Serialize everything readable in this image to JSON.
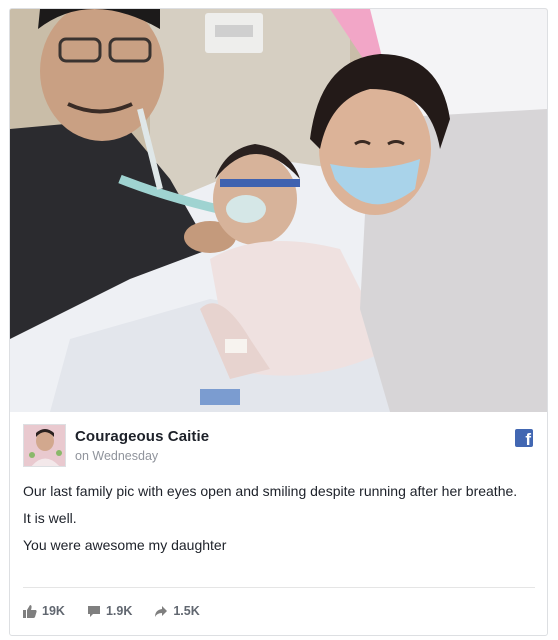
{
  "post": {
    "page_name": "Courageous Caitie",
    "time": "on Wednesday",
    "paragraphs": [
      "Our last family pic with eyes open and smiling despite running after her breathe.",
      "It is well.",
      "You were awesome my daughter"
    ]
  },
  "stats": {
    "likes": "19K",
    "comments": "1.9K",
    "shares": "1.5K"
  },
  "icons": {
    "like": "thumbs-up-icon",
    "comment": "comment-icon",
    "share": "share-arrow-icon",
    "brand": "facebook-icon"
  },
  "colors": {
    "facebook_blue": "#4267b2",
    "text": "#1d2129",
    "muted": "#90949c"
  }
}
